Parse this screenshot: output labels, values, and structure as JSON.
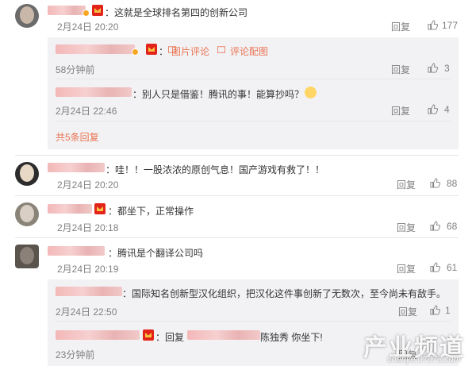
{
  "comments": [
    {
      "text": "：这就是全球排名第四的创新公司",
      "time": "2月24日 20:20",
      "reply": "回复",
      "likes": "177",
      "subreplies": [
        {
          "text": "：",
          "link1": "图片评论",
          "link2": "评论配图",
          "time": "58分钟前",
          "reply": "回复",
          "likes": "3"
        },
        {
          "text": "：别人只是借鉴！腾讯的事！能算抄吗？",
          "time": "2月24日 22:46",
          "reply": "回复",
          "likes": "4"
        }
      ],
      "more": "共5条回复"
    },
    {
      "text": "：哇！！一股浓浓的原创气息！国产游戏有救了！！",
      "time": "2月24日 20:20",
      "reply": "回复",
      "likes": "88"
    },
    {
      "text": "：都坐下，正常操作",
      "time": "2月24日 20:18",
      "reply": "回复",
      "likes": "68"
    },
    {
      "text": "：腾讯是个翻译公司吗",
      "time": "2月24日 20:19",
      "reply": "回复",
      "likes": "61",
      "subreplies": [
        {
          "text": "：国际知名创新型汉化组织，把汉化这件事创新了无数次，至今尚未有敌手。",
          "time": "2月24日 22:50",
          "reply": "回复",
          "likes": "1"
        },
        {
          "text": "：回复",
          "text2": "陈独秀 你坐下!",
          "time": "23分钟前",
          "reply": "回复"
        }
      ]
    }
  ],
  "watermark": {
    "main": "产业频道",
    "sub": "chanye.07073.com"
  },
  "colors": {
    "link": "#eb7350",
    "subbg": "#f2f2f5",
    "meta": "#808080"
  }
}
